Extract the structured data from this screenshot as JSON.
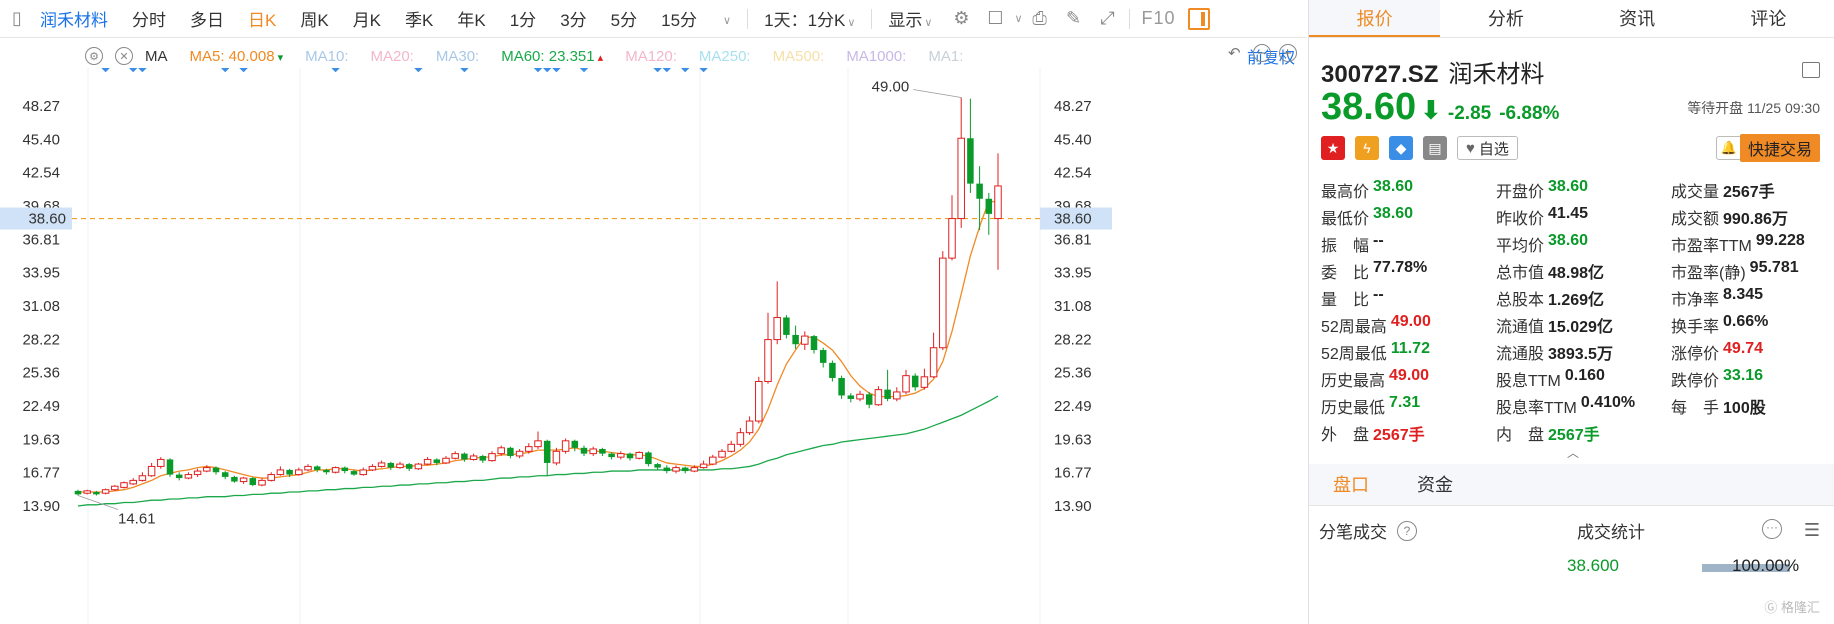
{
  "toolbar": {
    "stock_name": "润禾材料",
    "periods": [
      "分时",
      "多日",
      "日K",
      "周K",
      "月K",
      "季K",
      "年K",
      "1分",
      "3分",
      "5分",
      "15分"
    ],
    "active_period": 2,
    "interval_select": "1天：1分K",
    "display_label": "显示",
    "f10_label": "F10"
  },
  "ma_legend": {
    "ma_label": "MA",
    "items": [
      {
        "label": "MA5: 40.008",
        "color": "#f08a24"
      },
      {
        "label": "MA10:",
        "color": "#a8c8e8"
      },
      {
        "label": "MA20:",
        "color": "#f2b7c8"
      },
      {
        "label": "MA30:",
        "color": "#a8c8e8"
      },
      {
        "label": "MA60: 23.351",
        "color": "#1aa84a"
      },
      {
        "label": "MA120:",
        "color": "#f2b7c8"
      },
      {
        "label": "MA250:",
        "color": "#a8e0f0"
      },
      {
        "label": "MA500:",
        "color": "#f5e0a8"
      },
      {
        "label": "MA1000:",
        "color": "#c8b8e8"
      },
      {
        "label": "MA1:",
        "color": "#c8d0d8"
      }
    ],
    "adjust_label": "前复权"
  },
  "chart_data": {
    "type": "candlestick",
    "y_ticks": [
      48.27,
      45.4,
      42.54,
      39.68,
      36.81,
      33.95,
      31.08,
      28.22,
      25.36,
      22.49,
      19.63,
      16.77,
      13.9
    ],
    "ylim": [
      12.0,
      50.5
    ],
    "current_price_label": "38.60",
    "current_price": 38.6,
    "max_label": "49.00",
    "min_label": "14.61",
    "candles": [
      [
        15.2,
        14.9,
        15.3,
        14.8
      ],
      [
        15.0,
        15.2,
        15.3,
        14.9
      ],
      [
        15.1,
        14.9,
        15.2,
        14.8
      ],
      [
        15.0,
        15.3,
        15.4,
        14.9
      ],
      [
        15.3,
        15.6,
        15.7,
        15.2
      ],
      [
        15.5,
        15.9,
        16.0,
        15.4
      ],
      [
        15.8,
        16.1,
        16.3,
        15.7
      ],
      [
        16.1,
        16.5,
        16.8,
        16.0
      ],
      [
        16.5,
        17.3,
        17.6,
        16.4
      ],
      [
        17.3,
        17.9,
        18.1,
        17.1
      ],
      [
        17.9,
        16.6,
        18.0,
        16.4
      ],
      [
        16.6,
        16.3,
        16.8,
        16.1
      ],
      [
        16.3,
        16.6,
        16.8,
        16.2
      ],
      [
        16.6,
        16.9,
        17.1,
        16.4
      ],
      [
        16.9,
        17.2,
        17.4,
        16.8
      ],
      [
        17.2,
        16.8,
        17.3,
        16.6
      ],
      [
        16.8,
        16.4,
        16.9,
        16.2
      ],
      [
        16.4,
        16.0,
        16.5,
        15.9
      ],
      [
        16.0,
        16.3,
        16.4,
        15.8
      ],
      [
        16.3,
        15.7,
        16.4,
        15.6
      ],
      [
        15.7,
        16.1,
        16.3,
        15.6
      ],
      [
        16.1,
        16.6,
        16.8,
        16.0
      ],
      [
        16.6,
        17.0,
        17.3,
        16.5
      ],
      [
        17.0,
        16.6,
        17.1,
        16.4
      ],
      [
        16.6,
        17.0,
        17.2,
        16.5
      ],
      [
        17.0,
        17.3,
        17.5,
        16.9
      ],
      [
        17.3,
        17.0,
        17.4,
        16.8
      ],
      [
        17.0,
        16.8,
        17.1,
        16.6
      ],
      [
        16.8,
        17.2,
        17.3,
        16.7
      ],
      [
        17.2,
        16.9,
        17.3,
        16.7
      ],
      [
        16.9,
        16.6,
        17.0,
        16.5
      ],
      [
        16.6,
        17.0,
        17.2,
        16.5
      ],
      [
        17.0,
        17.3,
        17.5,
        16.9
      ],
      [
        17.3,
        17.6,
        17.8,
        17.2
      ],
      [
        17.6,
        17.2,
        17.7,
        17.0
      ],
      [
        17.2,
        17.5,
        17.7,
        17.1
      ],
      [
        17.5,
        17.1,
        17.6,
        16.9
      ],
      [
        17.1,
        17.5,
        17.6,
        17.0
      ],
      [
        17.5,
        17.9,
        18.1,
        17.4
      ],
      [
        17.9,
        17.6,
        18.0,
        17.4
      ],
      [
        17.6,
        18.0,
        18.2,
        17.5
      ],
      [
        18.0,
        18.4,
        18.6,
        17.9
      ],
      [
        18.4,
        17.9,
        18.5,
        17.7
      ],
      [
        17.9,
        18.2,
        18.4,
        17.8
      ],
      [
        18.2,
        17.8,
        18.3,
        17.6
      ],
      [
        17.8,
        18.4,
        18.6,
        17.7
      ],
      [
        18.4,
        18.9,
        19.1,
        18.2
      ],
      [
        18.9,
        18.2,
        19.0,
        18.0
      ],
      [
        18.2,
        18.6,
        18.8,
        18.0
      ],
      [
        18.6,
        19.0,
        19.3,
        18.4
      ],
      [
        19.0,
        19.5,
        20.3,
        18.8
      ],
      [
        19.5,
        17.6,
        19.6,
        16.5
      ],
      [
        17.6,
        18.6,
        18.9,
        17.4
      ],
      [
        18.6,
        19.5,
        19.7,
        18.4
      ],
      [
        19.5,
        18.9,
        19.6,
        18.6
      ],
      [
        18.9,
        18.4,
        19.1,
        18.2
      ],
      [
        18.4,
        18.8,
        19.0,
        18.2
      ],
      [
        18.8,
        18.4,
        18.9,
        18.2
      ],
      [
        18.4,
        18.1,
        18.5,
        17.9
      ],
      [
        18.1,
        18.4,
        18.6,
        17.9
      ],
      [
        18.4,
        18.0,
        18.5,
        17.8
      ],
      [
        18.0,
        18.5,
        18.6,
        17.9
      ],
      [
        18.5,
        17.5,
        18.6,
        17.3
      ],
      [
        17.5,
        17.2,
        17.6,
        17.0
      ],
      [
        17.2,
        16.9,
        17.4,
        16.7
      ],
      [
        16.9,
        17.2,
        17.4,
        16.7
      ],
      [
        17.2,
        16.9,
        17.3,
        16.7
      ],
      [
        16.9,
        17.2,
        17.4,
        16.8
      ],
      [
        17.2,
        17.5,
        17.8,
        17.1
      ],
      [
        17.5,
        18.1,
        18.3,
        17.4
      ],
      [
        18.1,
        18.6,
        18.8,
        18.0
      ],
      [
        18.6,
        19.2,
        19.5,
        18.5
      ],
      [
        19.2,
        20.2,
        20.6,
        19.0
      ],
      [
        20.2,
        21.2,
        21.6,
        20.0
      ],
      [
        21.2,
        24.6,
        25.0,
        21.0
      ],
      [
        24.6,
        28.2,
        30.5,
        24.4
      ],
      [
        28.2,
        30.1,
        33.2,
        27.8
      ],
      [
        30.1,
        28.6,
        30.3,
        28.3
      ],
      [
        28.6,
        27.8,
        29.4,
        27.4
      ],
      [
        27.8,
        28.5,
        28.9,
        27.3
      ],
      [
        28.5,
        27.3,
        28.6,
        27.0
      ],
      [
        27.3,
        26.2,
        27.5,
        25.8
      ],
      [
        26.2,
        24.9,
        26.4,
        24.6
      ],
      [
        24.9,
        23.4,
        25.1,
        23.1
      ],
      [
        23.4,
        23.1,
        23.6,
        22.8
      ],
      [
        23.1,
        23.5,
        23.8,
        22.9
      ],
      [
        23.5,
        22.6,
        23.7,
        22.3
      ],
      [
        22.6,
        23.9,
        24.2,
        22.5
      ],
      [
        23.9,
        23.1,
        25.6,
        22.9
      ],
      [
        23.1,
        23.7,
        24.1,
        22.9
      ],
      [
        23.7,
        25.1,
        25.6,
        23.5
      ],
      [
        25.1,
        24.1,
        25.3,
        23.8
      ],
      [
        24.1,
        25.0,
        25.7,
        23.9
      ],
      [
        25.0,
        27.5,
        28.8,
        24.9
      ],
      [
        27.5,
        35.2,
        35.8,
        27.3
      ],
      [
        35.2,
        38.6,
        40.6,
        35.0
      ],
      [
        38.6,
        45.5,
        49.0,
        37.8
      ],
      [
        45.5,
        41.6,
        48.9,
        40.8
      ],
      [
        41.6,
        40.3,
        43.1,
        37.6
      ],
      [
        40.3,
        39.0,
        40.8,
        37.2
      ],
      [
        38.6,
        41.4,
        44.2,
        34.2
      ]
    ],
    "ma5": [
      15.1,
      15.1,
      15.1,
      15.1,
      15.2,
      15.3,
      15.5,
      15.8,
      16.1,
      16.5,
      16.7,
      16.9,
      17.0,
      17.2,
      17.3,
      17.2,
      17.0,
      16.8,
      16.6,
      16.4,
      16.3,
      16.3,
      16.4,
      16.5,
      16.6,
      16.8,
      17.0,
      17.0,
      17.1,
      17.1,
      17.0,
      16.9,
      17.0,
      17.1,
      17.2,
      17.3,
      17.3,
      17.4,
      17.4,
      17.5,
      17.6,
      17.8,
      17.9,
      18.0,
      18.1,
      18.1,
      18.3,
      18.3,
      18.4,
      18.5,
      18.7,
      18.7,
      18.7,
      18.8,
      18.9,
      18.7,
      18.6,
      18.6,
      18.5,
      18.4,
      18.3,
      18.3,
      18.2,
      17.9,
      17.6,
      17.5,
      17.4,
      17.3,
      17.3,
      17.5,
      17.8,
      18.2,
      18.7,
      19.4,
      20.5,
      22.2,
      24.3,
      26.1,
      27.3,
      28.4,
      28.4,
      27.9,
      27.3,
      26.3,
      25.1,
      24.2,
      23.6,
      23.3,
      23.3,
      23.3,
      23.4,
      23.6,
      24.0,
      24.8,
      26.3,
      28.9,
      32.1,
      35.4,
      37.9,
      40.1,
      40.0
    ],
    "ma60": [
      13.9,
      14.0,
      14.0,
      14.1,
      14.1,
      14.2,
      14.2,
      14.3,
      14.4,
      14.4,
      14.5,
      14.5,
      14.6,
      14.6,
      14.7,
      14.7,
      14.7,
      14.8,
      14.8,
      14.9,
      14.9,
      15.0,
      15.0,
      15.1,
      15.1,
      15.2,
      15.2,
      15.3,
      15.3,
      15.4,
      15.4,
      15.5,
      15.5,
      15.6,
      15.6,
      15.7,
      15.7,
      15.8,
      15.8,
      15.9,
      15.9,
      16.0,
      16.0,
      16.1,
      16.1,
      16.2,
      16.3,
      16.3,
      16.4,
      16.4,
      16.5,
      16.5,
      16.6,
      16.6,
      16.7,
      16.7,
      16.8,
      16.8,
      16.9,
      16.9,
      16.9,
      17.0,
      17.0,
      17.0,
      17.0,
      17.0,
      17.0,
      17.0,
      17.0,
      17.0,
      17.1,
      17.1,
      17.2,
      17.3,
      17.5,
      17.8,
      18.0,
      18.3,
      18.5,
      18.7,
      18.9,
      19.1,
      19.2,
      19.4,
      19.5,
      19.6,
      19.7,
      19.8,
      19.9,
      20.0,
      20.1,
      20.3,
      20.5,
      20.8,
      21.1,
      21.4,
      21.7,
      22.1,
      22.5,
      22.9,
      23.35
    ],
    "signal_markers": [
      3,
      6,
      7,
      16,
      18,
      28,
      37,
      42,
      50,
      51,
      52,
      55,
      63,
      64,
      66,
      68
    ]
  },
  "tabs": [
    "报价",
    "分析",
    "资讯",
    "评论"
  ],
  "quote": {
    "code": "300727.SZ",
    "name": "润禾材料",
    "price": "38.60",
    "change": "-2.85",
    "change_pct": "-6.88%",
    "status": "等待开盘 11/25 09:30",
    "watch_label": "自选",
    "quick_trade_label": "快捷交易",
    "badges": [
      {
        "icon": "china-flag-icon",
        "color": "#e02020",
        "glyph": "★"
      },
      {
        "icon": "lightning-icon",
        "color": "#f0a020",
        "glyph": "ϟ"
      },
      {
        "icon": "tag-icon",
        "color": "#3a8ee6",
        "glyph": "◆"
      },
      {
        "icon": "bookmark-icon",
        "color": "#888888",
        "glyph": "▤"
      }
    ]
  },
  "stats": [
    [
      [
        "最高价",
        "38.60",
        "g"
      ],
      [
        "开盘价",
        "38.60",
        "g"
      ],
      [
        "成交量",
        "2567手",
        "k"
      ]
    ],
    [
      [
        "最低价",
        "38.60",
        "g"
      ],
      [
        "昨收价",
        "41.45",
        "k"
      ],
      [
        "成交额",
        "990.86万",
        "k"
      ]
    ],
    [
      [
        "振　幅",
        "--",
        "k"
      ],
      [
        "平均价",
        "38.60",
        "g"
      ],
      [
        "市盈率TTM",
        "99.228",
        "k"
      ]
    ],
    [
      [
        "委　比",
        "77.78%",
        "k"
      ],
      [
        "总市值",
        "48.98亿",
        "k"
      ],
      [
        "市盈率(静)",
        "95.781",
        "k"
      ]
    ],
    [
      [
        "量　比",
        "--",
        "k"
      ],
      [
        "总股本",
        "1.269亿",
        "k"
      ],
      [
        "市净率",
        "8.345",
        "k"
      ]
    ],
    [
      [
        "52周最高",
        "49.00",
        "r"
      ],
      [
        "流通值",
        "15.029亿",
        "k"
      ],
      [
        "换手率",
        "0.66%",
        "k"
      ]
    ],
    [
      [
        "52周最低",
        "11.72",
        "g"
      ],
      [
        "流通股",
        "3893.5万",
        "k"
      ],
      [
        "涨停价",
        "49.74",
        "r"
      ]
    ],
    [
      [
        "历史最高",
        "49.00",
        "r"
      ],
      [
        "股息TTM",
        "0.160",
        "k"
      ],
      [
        "跌停价",
        "33.16",
        "g"
      ]
    ],
    [
      [
        "历史最低",
        "7.31",
        "g"
      ],
      [
        "股息率TTM",
        "0.410%",
        "k"
      ],
      [
        "每　手",
        "100股",
        "k"
      ]
    ],
    [
      [
        "外　盘",
        "2567手",
        "r"
      ],
      [
        "内　盘",
        "2567手",
        "g"
      ],
      [
        "",
        "",
        " k"
      ]
    ]
  ],
  "sub_tabs": [
    "盘口",
    "资金"
  ],
  "trades": {
    "title": "分笔成交",
    "stats_title": "成交统计",
    "price": "38.600",
    "pct": "100.00%"
  },
  "watermark": "格隆汇"
}
